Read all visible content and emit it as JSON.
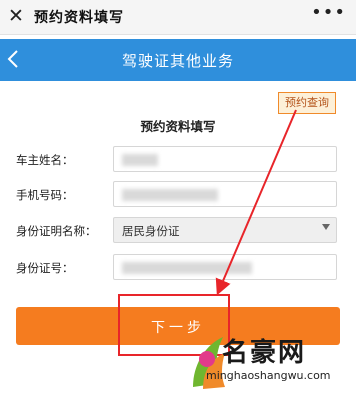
{
  "window": {
    "title": "预约资料填写",
    "close_icon": "close-icon",
    "more_icon": "more-dots-icon"
  },
  "header": {
    "title": "驾驶证其他业务",
    "back_icon": "chevron-left-icon"
  },
  "query_link": "预约查询",
  "form": {
    "title": "预约资料填写",
    "fields": [
      {
        "label": "车主姓名：",
        "value": ""
      },
      {
        "label": "手机号码：",
        "value": ""
      },
      {
        "label": "身份证明名称：",
        "value": "居民身份证"
      },
      {
        "label": "身份证号：",
        "value": ""
      }
    ],
    "next_button": "下一步"
  },
  "colors": {
    "accent_blue": "#2f8fdc",
    "button_orange": "#f57c1f",
    "annotation_red": "#e8252a"
  },
  "watermark": {
    "name": "名豪网",
    "url": "minghaoshangwu.com"
  }
}
